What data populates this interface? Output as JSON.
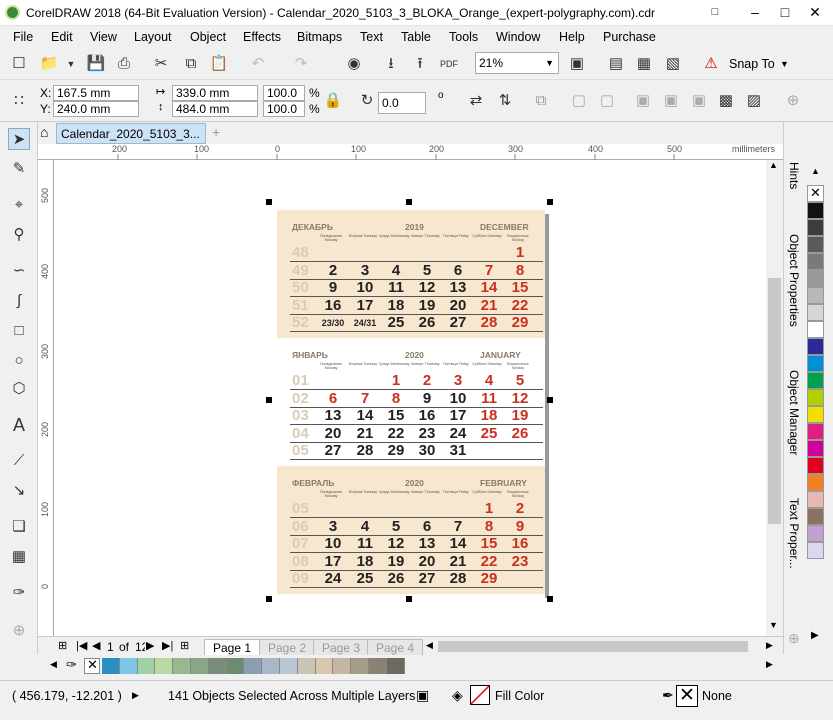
{
  "title": "CorelDRAW 2018 (64-Bit Evaluation Version) - Calendar_2020_5103_3_BLOKA_Orange_(expert-polygraphy.com).cdr",
  "menu": [
    "File",
    "Edit",
    "View",
    "Layout",
    "Object",
    "Effects",
    "Bitmaps",
    "Text",
    "Table",
    "Tools",
    "Window",
    "Help",
    "Purchase"
  ],
  "toolbar": {
    "zoom": "21%",
    "snap_label": "Snap To",
    "pdf_label": "PDF"
  },
  "props": {
    "x": "167.5 mm",
    "y": "240.0 mm",
    "w": "339.0 mm",
    "h": "484.0 mm",
    "sx": "100.0",
    "sy": "100.0",
    "pct": "%",
    "angle": "0.0",
    "deg": "o",
    "xl": "X:",
    "yl": "Y:"
  },
  "doc_tab": "Calendar_2020_5103_3...",
  "ruler_h": {
    "labels": [
      "200",
      "100",
      "0",
      "100",
      "200",
      "300",
      "400",
      "500"
    ],
    "unit": "millimeters"
  },
  "ruler_v": {
    "labels": [
      "500",
      "400",
      "300",
      "200",
      "100",
      "0"
    ]
  },
  "pages": {
    "current": "1",
    "of": "of",
    "total": "12",
    "tabs": [
      "Page 1",
      "Page 2",
      "Page 3",
      "Page 4"
    ]
  },
  "status": {
    "coords": "( 456.179, -12.201 )",
    "selection": "141 Objects Selected Across Multiple Layers",
    "fill": "Fill Color",
    "outline": "None"
  },
  "dockers": [
    "Hints",
    "Object Properties",
    "Object Manager",
    "Text Proper..."
  ],
  "palette_bottom": [
    "#2a8fc4",
    "#7dc6e4",
    "#9fd0a6",
    "#b8d9a0",
    "#98b890",
    "#8aa588",
    "#7a8d78",
    "#6c8b70",
    "#8a9fb3",
    "#a8b8c8",
    "#b7c8d4",
    "#c9c4b4",
    "#d8c7ae",
    "#c4b6a0",
    "#a69c8a",
    "#8c8272",
    "#6e6a60"
  ],
  "palette_right": [
    "#ffffff",
    "#111111",
    "#3c3c3c",
    "#5a5a5a",
    "#7a7a7a",
    "#999999",
    "#b8b8b8",
    "#d6d6d6",
    "#ffffff",
    "#2a2a9a",
    "#0090d8",
    "#00a050",
    "#b0d000",
    "#f0e000",
    "#e02080",
    "#d0009a",
    "#e00020",
    "#f08020",
    "#e8b8b0",
    "#8c7060",
    "#c0a0d0",
    "#d8d8f0"
  ],
  "calendar": {
    "blocks": [
      {
        "ru": "ДЕКАБРЬ",
        "year": "2019",
        "en": "DECEMBER",
        "bg": "#f7e7cf",
        "weekdays": [
          "Понедельник Monday",
          "Вторник Tuesday",
          "Среда Wednesday",
          "Четверг Thursday",
          "Пятница Friday",
          "Суббота Saturday",
          "Воскресенье Sunday"
        ],
        "rows": [
          {
            "wk": "48",
            "days": [
              "",
              "",
              "",
              "",
              "",
              "",
              "1"
            ],
            "red": [
              6
            ]
          },
          {
            "wk": "49",
            "days": [
              "2",
              "3",
              "4",
              "5",
              "6",
              "7",
              "8"
            ],
            "red": [
              5,
              6
            ]
          },
          {
            "wk": "50",
            "days": [
              "9",
              "10",
              "11",
              "12",
              "13",
              "14",
              "15"
            ],
            "red": [
              5,
              6
            ]
          },
          {
            "wk": "51",
            "days": [
              "16",
              "17",
              "18",
              "19",
              "20",
              "21",
              "22"
            ],
            "red": [
              5,
              6
            ]
          },
          {
            "wk": "52",
            "days": [
              "23/30",
              "24/31",
              "25",
              "26",
              "27",
              "28",
              "29"
            ],
            "red": [
              5,
              6
            ]
          }
        ]
      },
      {
        "ru": "ЯНВАРЬ",
        "year": "2020",
        "en": "JANUARY",
        "bg": "#ffffff",
        "weekdays": [
          "Понедельник Monday",
          "Вторник Tuesday",
          "Среда Wednesday",
          "Четверг Thursday",
          "Пятница Friday",
          "Суббота Saturday",
          "Воскресенье Sunday"
        ],
        "rows": [
          {
            "wk": "01",
            "days": [
              "",
              "",
              "1",
              "2",
              "3",
              "4",
              "5"
            ],
            "red": [
              2,
              3,
              4,
              5,
              6
            ]
          },
          {
            "wk": "02",
            "days": [
              "6",
              "7",
              "8",
              "9",
              "10",
              "11",
              "12"
            ],
            "red": [
              0,
              1,
              2,
              5,
              6
            ]
          },
          {
            "wk": "03",
            "days": [
              "13",
              "14",
              "15",
              "16",
              "17",
              "18",
              "19"
            ],
            "red": [
              5,
              6
            ]
          },
          {
            "wk": "04",
            "days": [
              "20",
              "21",
              "22",
              "23",
              "24",
              "25",
              "26"
            ],
            "red": [
              5,
              6
            ]
          },
          {
            "wk": "05",
            "days": [
              "27",
              "28",
              "29",
              "30",
              "31",
              "",
              ""
            ],
            "red": []
          }
        ]
      },
      {
        "ru": "ФЕВРАЛЬ",
        "year": "2020",
        "en": "FEBRUARY",
        "bg": "#f7e7cf",
        "weekdays": [
          "Понедельник Monday",
          "Вторник Tuesday",
          "Среда Wednesday",
          "Четверг Thursday",
          "Пятница Friday",
          "Суббота Saturday",
          "Воскресенье Sunday"
        ],
        "rows": [
          {
            "wk": "05",
            "days": [
              "",
              "",
              "",
              "",
              "",
              "1",
              "2"
            ],
            "red": [
              5,
              6
            ]
          },
          {
            "wk": "06",
            "days": [
              "3",
              "4",
              "5",
              "6",
              "7",
              "8",
              "9"
            ],
            "red": [
              5,
              6
            ]
          },
          {
            "wk": "07",
            "days": [
              "10",
              "11",
              "12",
              "13",
              "14",
              "15",
              "16"
            ],
            "red": [
              5,
              6
            ]
          },
          {
            "wk": "08",
            "days": [
              "17",
              "18",
              "19",
              "20",
              "21",
              "22",
              "23"
            ],
            "red": [
              5,
              6
            ]
          },
          {
            "wk": "09",
            "days": [
              "24",
              "25",
              "26",
              "27",
              "28",
              "29",
              ""
            ],
            "red": [
              5
            ]
          }
        ]
      }
    ]
  }
}
